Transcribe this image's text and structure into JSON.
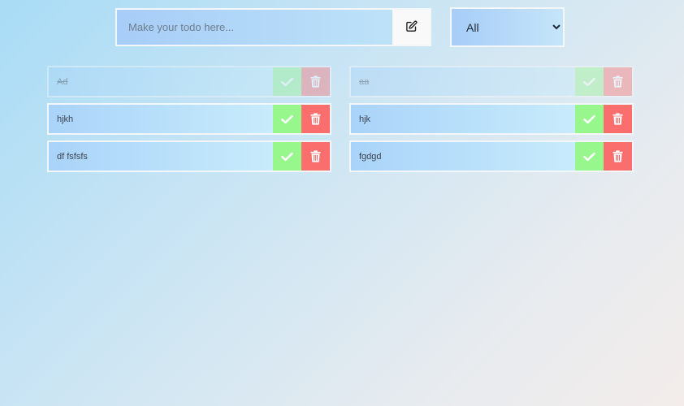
{
  "form": {
    "input_value": "",
    "input_placeholder": "Make your todo here...",
    "add_icon": "edit-icon"
  },
  "filter": {
    "selected": "All",
    "options": [
      "All"
    ]
  },
  "icons": {
    "complete": "check-icon",
    "delete": "trash-icon"
  },
  "colors": {
    "complete_button": "#98f78c",
    "delete_button": "#fb6e6e"
  },
  "todos": [
    {
      "text": "Ad",
      "completed": true
    },
    {
      "text": "aa",
      "completed": true
    },
    {
      "text": "hjkh",
      "completed": false
    },
    {
      "text": "hjk",
      "completed": false
    },
    {
      "text": "df fsfsfs",
      "completed": false
    },
    {
      "text": "fgdgd",
      "completed": false
    }
  ]
}
